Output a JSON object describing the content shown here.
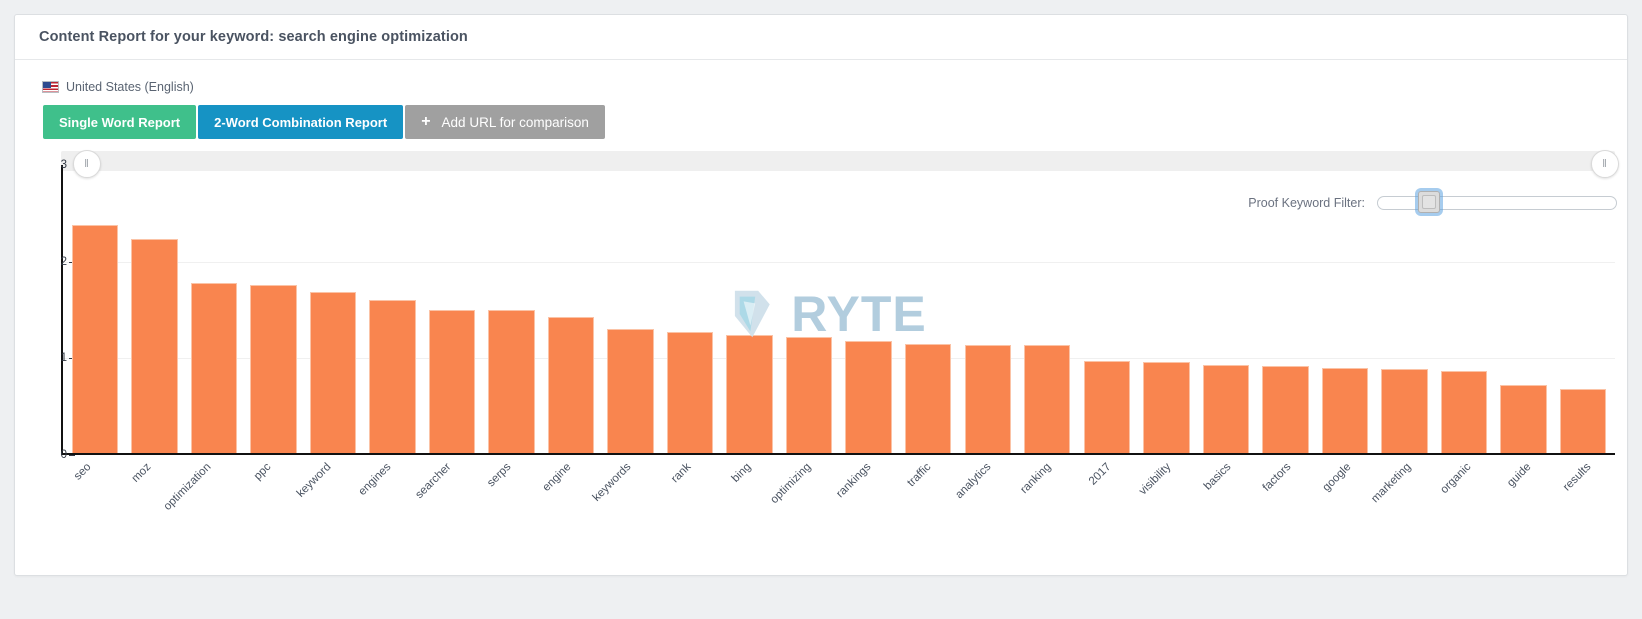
{
  "panel": {
    "title": "Content Report for your keyword: search engine optimization"
  },
  "locale": {
    "flag_icon": "us-flag-icon",
    "label": "United States (English)"
  },
  "buttons": {
    "single_word": "Single Word Report",
    "two_word": "2-Word Combination Report",
    "add_url_plus": "+",
    "add_url": "Add URL for comparison"
  },
  "filter": {
    "label": "Proof Keyword Filter:",
    "handle_position_percent": 17
  },
  "scrollbar": {
    "left_grip_icon": "drag-handle-icon",
    "right_grip_icon": "drag-handle-icon",
    "grip_glyph": "‖"
  },
  "watermark": {
    "logo_icon": "ryte-diamond-logo-icon",
    "text": "RYTE"
  },
  "colors": {
    "bar": "#f9854f",
    "bar_border": "#fbc3a6",
    "green_button": "#3fc08b",
    "blue_button": "#1693c4",
    "gray_button": "#a0a0a0",
    "watermark": "#aecbdd"
  },
  "chart_data": {
    "type": "bar",
    "title": "Content Report for your keyword: search engine optimization",
    "xlabel": "",
    "ylabel": "",
    "ylim": [
      0,
      3
    ],
    "yticks": [
      0,
      1,
      2,
      3
    ],
    "gridlines": [
      1,
      2
    ],
    "grid": true,
    "legend": "none",
    "categories": [
      "seo",
      "moz",
      "optimization",
      "ppc",
      "keyword",
      "engines",
      "searcher",
      "serps",
      "engine",
      "keywords",
      "rank",
      "bing",
      "optimizing",
      "rankings",
      "traffic",
      "analytics",
      "ranking",
      "2017",
      "visibility",
      "basics",
      "factors",
      "google",
      "marketing",
      "organic",
      "guide",
      "results"
    ],
    "values": [
      2.37,
      2.23,
      1.77,
      1.75,
      1.68,
      1.59,
      1.49,
      1.49,
      1.42,
      1.29,
      1.26,
      1.23,
      1.21,
      1.17,
      1.14,
      1.12,
      1.12,
      0.96,
      0.95,
      0.92,
      0.91,
      0.89,
      0.88,
      0.85,
      0.71,
      0.67
    ]
  }
}
